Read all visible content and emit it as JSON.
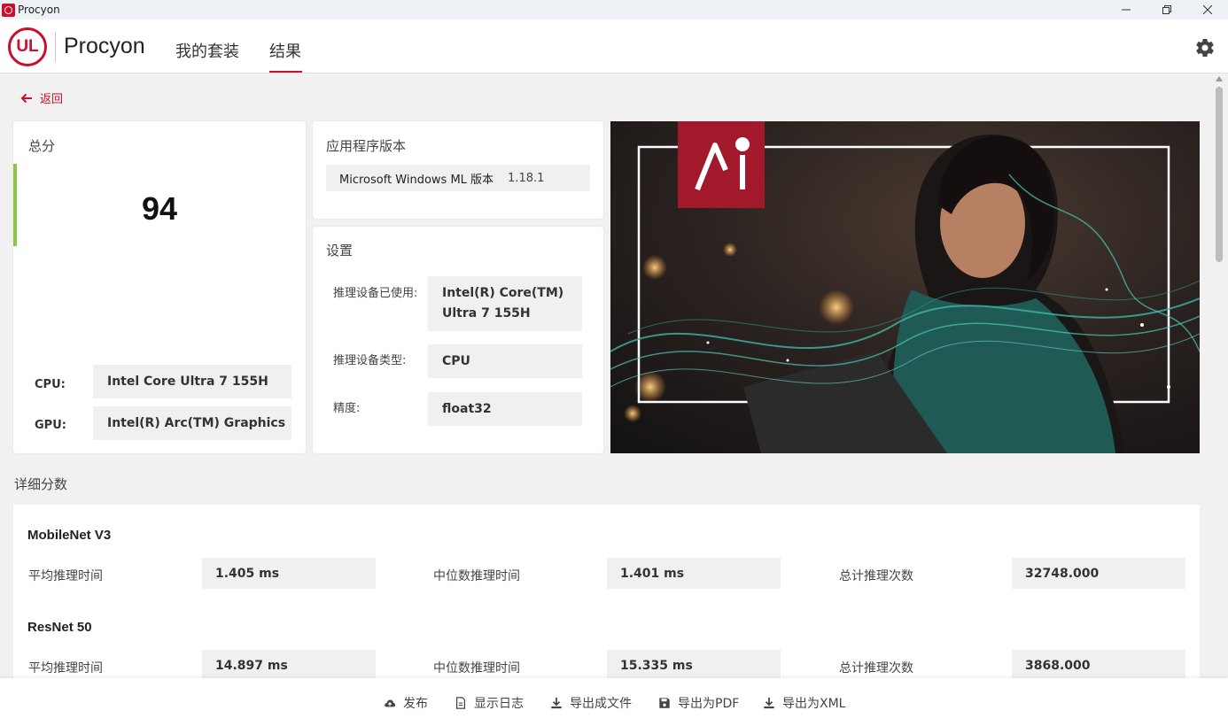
{
  "window": {
    "title": "Procyon"
  },
  "header": {
    "logo_text": "UL",
    "brand": "Procyon",
    "tabs": [
      {
        "label": "我的套装"
      },
      {
        "label": "结果",
        "active": true
      }
    ]
  },
  "back_label": "返回",
  "total_card": {
    "title": "总分",
    "score": "94",
    "cpu_label": "CPU:",
    "cpu_value": "Intel Core Ultra 7 155H",
    "gpu_label": "GPU:",
    "gpu_value": "Intel(R) Arc(TM) Graphics"
  },
  "version_card": {
    "title": "应用程序版本",
    "name": "Microsoft Windows ML 版本",
    "version": "1.18.1"
  },
  "settings_card": {
    "title": "设置",
    "rows": [
      {
        "label": "推理设备已使用:",
        "value": "Intel(R) Core(TM) Ultra 7 155H"
      },
      {
        "label": "推理设备类型:",
        "value": "CPU"
      },
      {
        "label": "精度:",
        "value": "float32"
      }
    ]
  },
  "hero": {
    "badge_text": "AI"
  },
  "details": {
    "title": "详细分数",
    "benchmarks": [
      {
        "name": "MobileNet V3",
        "avg_label": "平均推理时间",
        "avg": "1.405 ms",
        "median_label": "中位数推理时间",
        "median": "1.401 ms",
        "total_label": "总计推理次数",
        "total": "32748.000"
      },
      {
        "name": "ResNet 50",
        "avg_label": "平均推理时间",
        "avg": "14.897 ms",
        "median_label": "中位数推理时间",
        "median": "15.335 ms",
        "total_label": "总计推理次数",
        "total": "3868.000"
      }
    ]
  },
  "footer": {
    "publish": "发布",
    "show_log": "显示日志",
    "export_file": "导出成文件",
    "export_pdf": "导出为PDF",
    "export_xml": "导出为XML"
  },
  "colors": {
    "accent": "#c8102e",
    "score_bar": "#8cc63f",
    "background": "#f1f1f1"
  }
}
